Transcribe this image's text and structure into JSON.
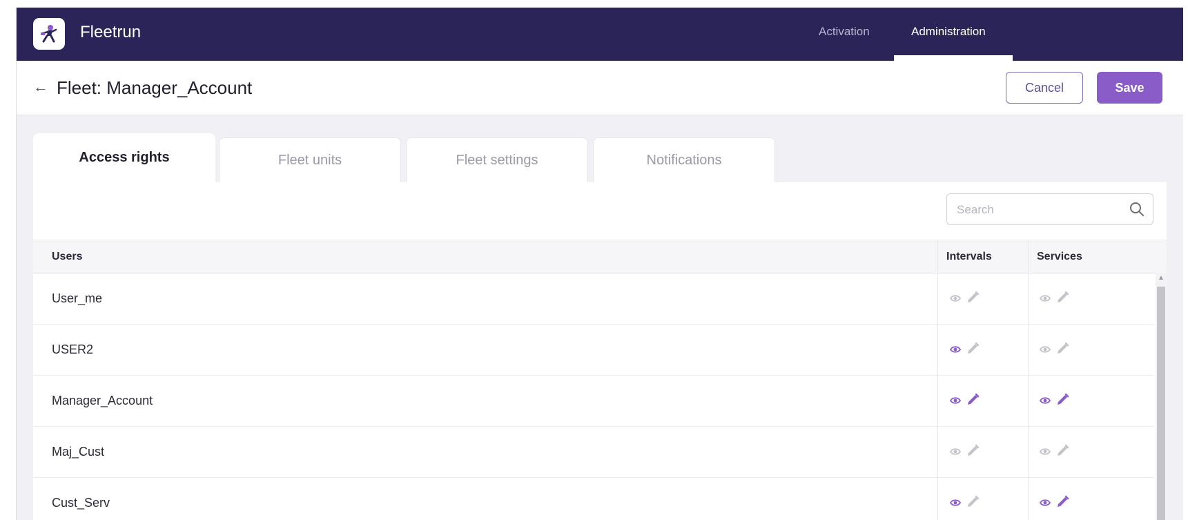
{
  "app": {
    "name": "Fleetrun"
  },
  "nav": {
    "tabs": [
      {
        "label": "Activation"
      },
      {
        "label": "Administration"
      }
    ],
    "active": "Administration"
  },
  "header": {
    "title": "Fleet: Manager_Account",
    "cancel_label": "Cancel",
    "save_label": "Save"
  },
  "tabs": [
    {
      "label": "Access rights"
    },
    {
      "label": "Fleet units"
    },
    {
      "label": "Fleet settings"
    },
    {
      "label": "Notifications"
    }
  ],
  "active_tab": "Access rights",
  "search": {
    "placeholder": "Search",
    "value": ""
  },
  "table": {
    "columns": {
      "users": "Users",
      "intervals": "Intervals",
      "services": "Services"
    },
    "rows": [
      {
        "user": "User_me",
        "intervals": {
          "view": false,
          "edit": false
        },
        "services": {
          "view": false,
          "edit": false
        }
      },
      {
        "user": "USER2",
        "intervals": {
          "view": true,
          "edit": false
        },
        "services": {
          "view": false,
          "edit": false
        }
      },
      {
        "user": "Manager_Account",
        "intervals": {
          "view": true,
          "edit": true
        },
        "services": {
          "view": true,
          "edit": true
        }
      },
      {
        "user": "Maj_Cust",
        "intervals": {
          "view": false,
          "edit": false
        },
        "services": {
          "view": false,
          "edit": false
        }
      },
      {
        "user": "Cust_Serv",
        "intervals": {
          "view": true,
          "edit": false
        },
        "services": {
          "view": true,
          "edit": true
        }
      }
    ]
  },
  "icons": {
    "back": "arrow-left-icon",
    "search": "search-icon",
    "view": "eye-icon",
    "edit": "pencil-icon"
  },
  "colors": {
    "topbar": "#2b2459",
    "accent": "#8a5cc8",
    "permission_on": "#8a5cc8",
    "permission_off": "#c3c3cb"
  }
}
